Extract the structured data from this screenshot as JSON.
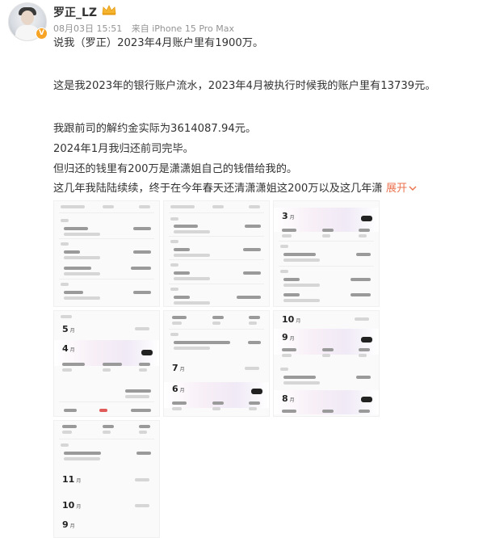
{
  "post": {
    "username": "罗正_LZ",
    "verified_badge": "V",
    "date": "08月03日 15:51",
    "source": "来自 iPhone 15 Pro Max",
    "paragraphs": [
      "说我（罗正）2023年4月账户里有1900万。",
      "这是我2023年的银行账户流水，2023年4月被执行时候我的账户里有13739元。",
      "我跟前司的解约金实际为3614087.94元。",
      "2024年1月我归还前司完毕。",
      "但归还的钱里有200万是潇潇姐自己的钱借给我的。",
      "这几年我陆陆续续，终于在今年春天还清潇潇姐这200万以及这几年潇"
    ],
    "expand_label": "展开",
    "expand_icon": "chevron-down-icon",
    "accent_color": "#eb7350"
  },
  "images": [
    {
      "name": "statement-jan-feb",
      "months": []
    },
    {
      "name": "statement-feb-mar",
      "months": []
    },
    {
      "name": "statement-mar",
      "months": [
        {
          "label": "3",
          "unit": "月"
        }
      ]
    },
    {
      "name": "statement-may-apr",
      "months": [
        {
          "label": "5",
          "unit": "月"
        },
        {
          "label": "4",
          "unit": "月"
        }
      ]
    },
    {
      "name": "statement-jul-jun",
      "months": [
        {
          "label": "7",
          "unit": "月"
        },
        {
          "label": "6",
          "unit": "月"
        }
      ]
    },
    {
      "name": "statement-oct-sep-aug",
      "months": [
        {
          "label": "10",
          "unit": "月"
        },
        {
          "label": "9",
          "unit": "月"
        },
        {
          "label": "8",
          "unit": "月"
        }
      ]
    },
    {
      "name": "statement-nov-oct-sep",
      "months": [
        {
          "label": "11",
          "unit": "月"
        },
        {
          "label": "10",
          "unit": "月"
        },
        {
          "label": "9",
          "unit": "月"
        }
      ]
    }
  ]
}
